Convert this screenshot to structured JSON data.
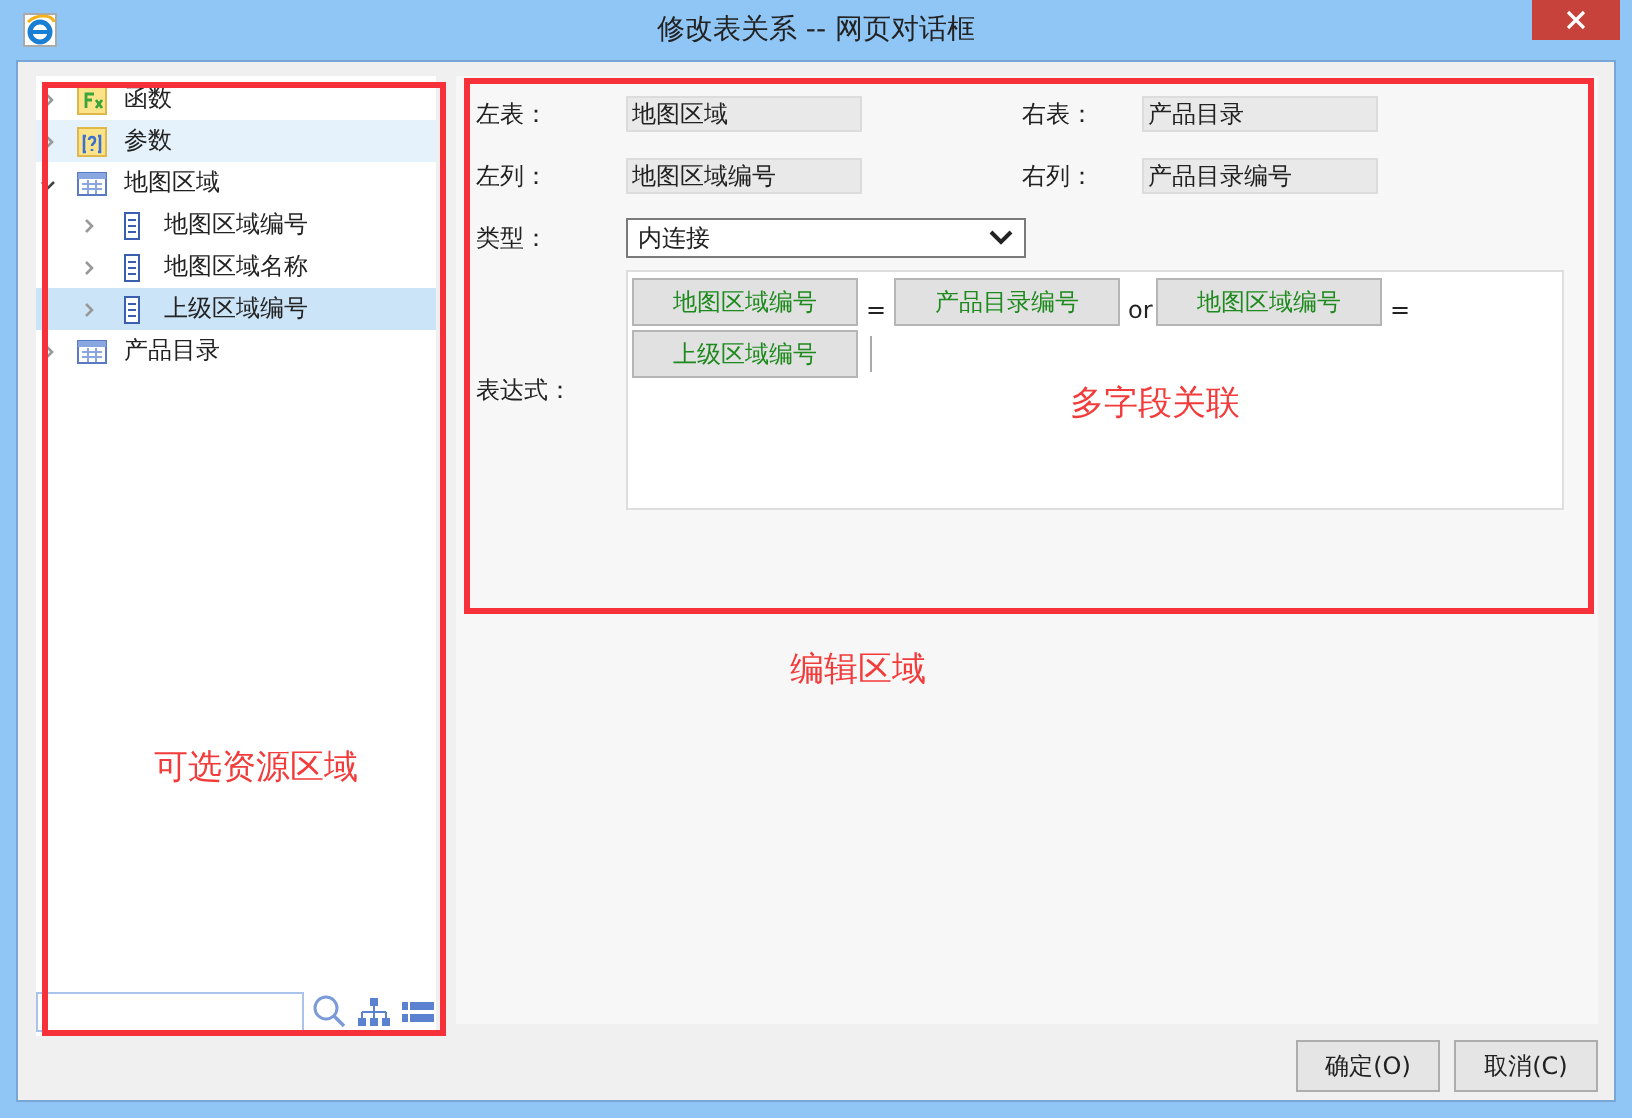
{
  "window": {
    "title": "修改表关系 -- 网页对话框"
  },
  "tree": [
    {
      "label": "函数",
      "kind": "function",
      "expanded": false,
      "selected": false,
      "hover": false
    },
    {
      "label": "参数",
      "kind": "parameter",
      "expanded": false,
      "selected": false,
      "hover": true
    },
    {
      "label": "地图区域",
      "kind": "table",
      "expanded": true,
      "selected": false,
      "hover": false,
      "children": [
        {
          "label": "地图区域编号",
          "kind": "field",
          "expanded": false,
          "selected": false,
          "hover": false
        },
        {
          "label": "地图区域名称",
          "kind": "field",
          "expanded": false,
          "selected": false,
          "hover": false
        },
        {
          "label": "上级区域编号",
          "kind": "field",
          "expanded": false,
          "selected": true,
          "hover": false
        }
      ]
    },
    {
      "label": "产品目录",
      "kind": "table",
      "expanded": false,
      "selected": false,
      "hover": false
    }
  ],
  "form": {
    "left_table_label": "左表：",
    "left_table": "地图区域",
    "right_table_label": "右表：",
    "right_table": "产品目录",
    "left_column_label": "左列：",
    "left_column": "地图区域编号",
    "right_column_label": "右列：",
    "right_column": "产品目录编号",
    "type_label": "类型：",
    "type": "内连接",
    "expression_label": "表达式：",
    "expression": [
      {
        "kind": "field",
        "text": "地图区域编号"
      },
      {
        "kind": "operator",
        "text": "="
      },
      {
        "kind": "field",
        "text": "产品目录编号"
      },
      {
        "kind": "operator",
        "text": "or"
      },
      {
        "kind": "field",
        "text": "地图区域编号"
      },
      {
        "kind": "operator",
        "text": "="
      },
      {
        "kind": "field",
        "text": "上级区域编号"
      }
    ]
  },
  "annotations": {
    "tree": "可选资源区域",
    "editor": "编辑区域",
    "expression": "多字段关联"
  },
  "buttons": [
    "确定(O)",
    "取消(C)"
  ]
}
